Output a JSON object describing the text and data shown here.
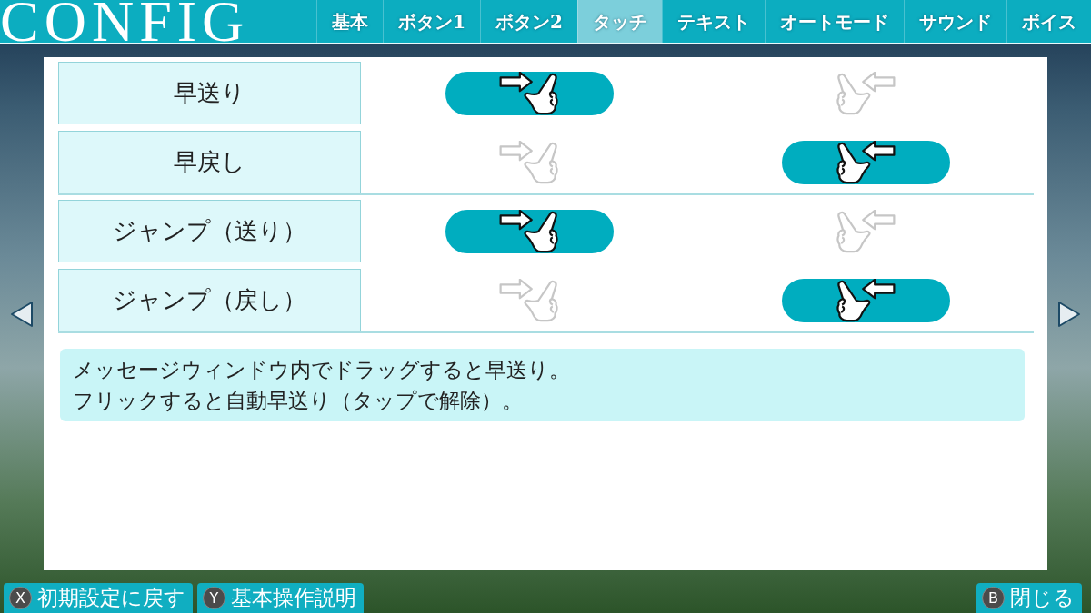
{
  "title": "CONFIG",
  "tabs": [
    {
      "label": "基本",
      "selected": false
    },
    {
      "label": "ボタン1",
      "selected": false
    },
    {
      "label": "ボタン2",
      "selected": false
    },
    {
      "label": "タッチ",
      "selected": true
    },
    {
      "label": "テキスト",
      "selected": false
    },
    {
      "label": "オートモード",
      "selected": false
    },
    {
      "label": "サウンド",
      "selected": false
    },
    {
      "label": "ボイス",
      "selected": false
    }
  ],
  "groups": [
    {
      "rows": [
        {
          "label": "早送り",
          "options": [
            {
              "kind": "swipe-right",
              "selected": true
            },
            {
              "kind": "swipe-left",
              "selected": false
            }
          ]
        },
        {
          "label": "早戻し",
          "options": [
            {
              "kind": "swipe-right",
              "selected": false
            },
            {
              "kind": "swipe-left",
              "selected": true
            }
          ]
        }
      ]
    },
    {
      "rows": [
        {
          "label": "ジャンプ（送り）",
          "options": [
            {
              "kind": "swipe-right",
              "selected": true
            },
            {
              "kind": "swipe-left",
              "selected": false
            }
          ]
        },
        {
          "label": "ジャンプ（戻し）",
          "options": [
            {
              "kind": "swipe-right",
              "selected": false
            },
            {
              "kind": "swipe-left",
              "selected": true
            }
          ]
        }
      ]
    }
  ],
  "help_text": [
    "メッセージウィンドウ内でドラッグすると早送り。",
    "フリックすると自動早送り（タップで解除）。"
  ],
  "footer_buttons": [
    {
      "key": "X",
      "label": "初期設定に戻す"
    },
    {
      "key": "Y",
      "label": "基本操作説明"
    }
  ],
  "close_button": {
    "key": "B",
    "label": "閉じる"
  }
}
